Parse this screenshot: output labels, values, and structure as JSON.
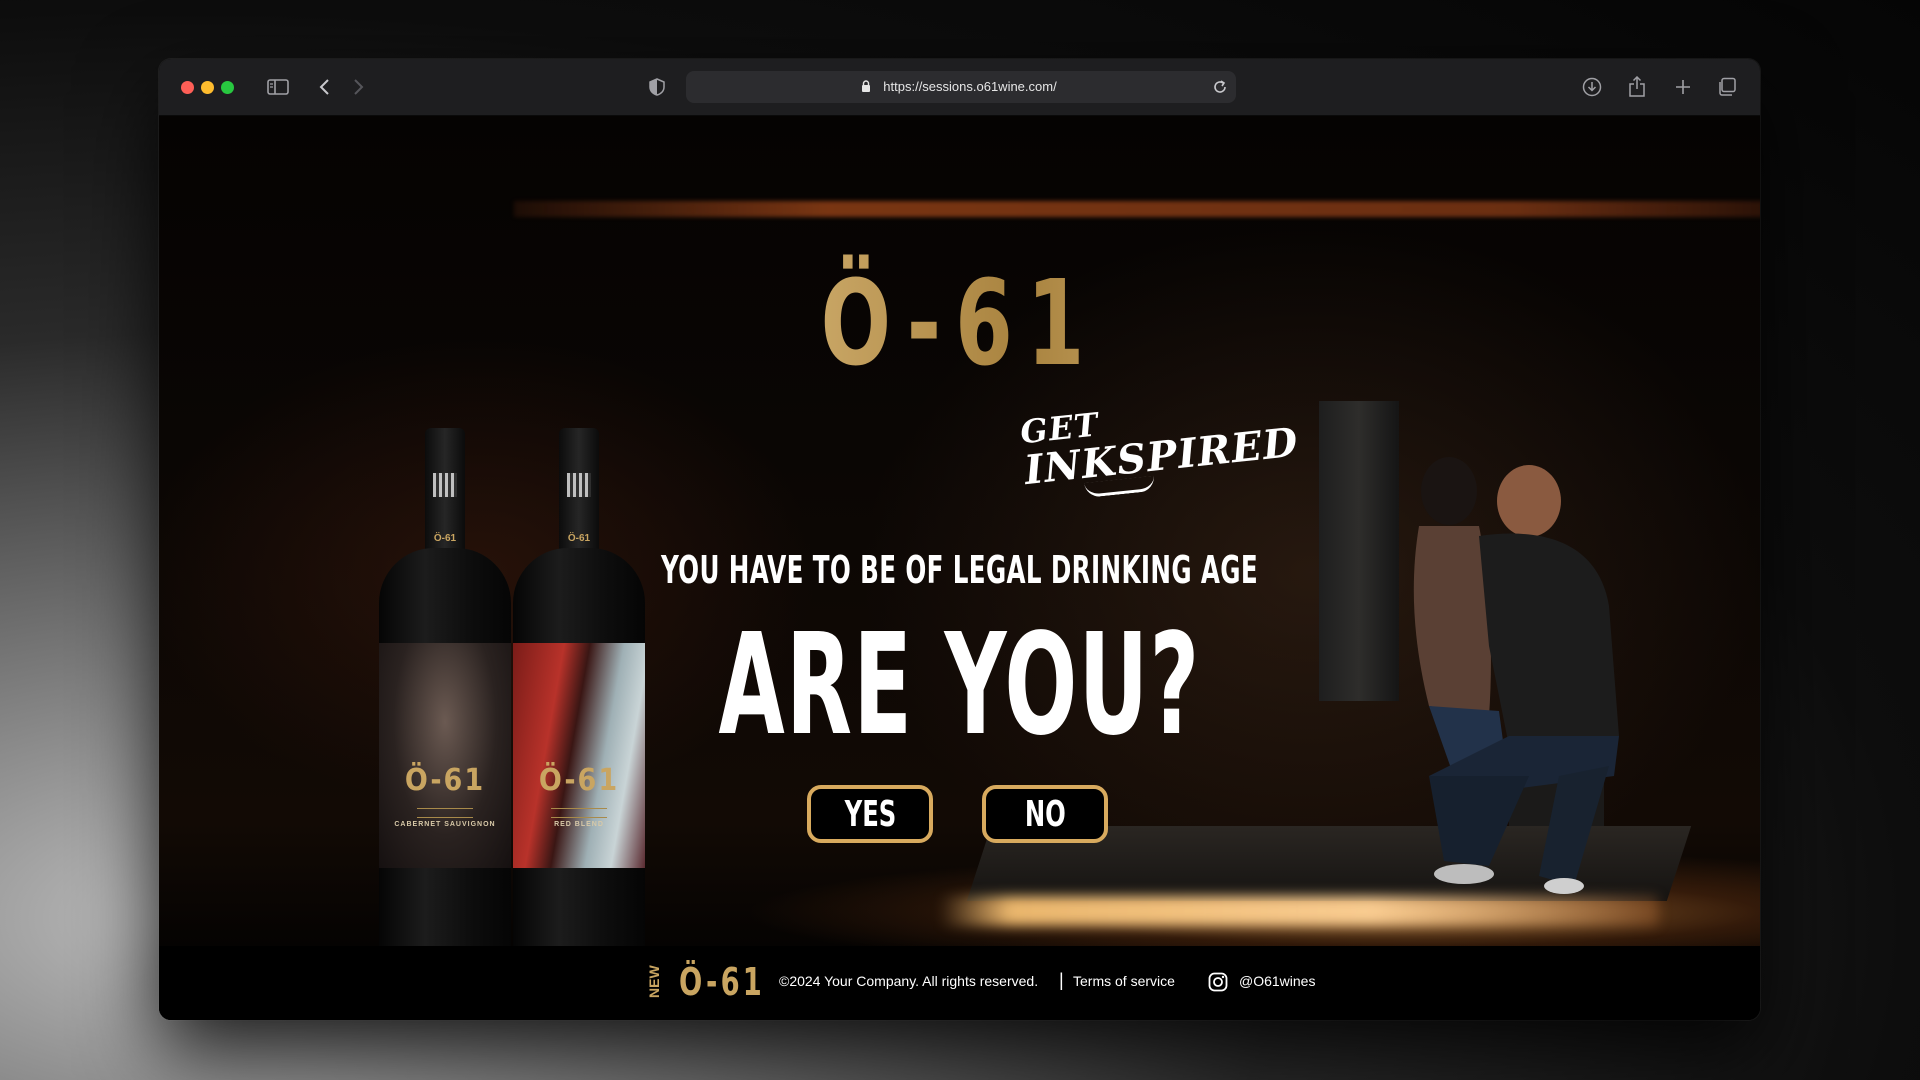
{
  "browser": {
    "url": "https://sessions.o61wine.com/",
    "traffic_lights": {
      "close": "#fe5f57",
      "minimize": "#febc2e",
      "zoom": "#28c840"
    },
    "toolbar_icons": [
      "sidebar-icon",
      "back-icon",
      "forward-icon",
      "shield-icon",
      "lock-icon",
      "reload-icon",
      "download-icon",
      "share-icon",
      "new-tab-icon",
      "tab-overview-icon"
    ]
  },
  "hero": {
    "brand": "Ö-61",
    "tagline_line1": "GET",
    "tagline_line2": "INKSPIRED",
    "age_notice": "YOU HAVE TO BE OF LEGAL DRINKING AGE",
    "question": "ARE YOU?",
    "yes_label": "YES",
    "no_label": "NO",
    "accent_color": "#d8aa5e"
  },
  "bottles": [
    {
      "brand": "Ö-61",
      "varietal": "CABERNET SAUVIGNON",
      "label_colors": [
        "#6b5a52",
        "#2a2220",
        "#8a7566"
      ]
    },
    {
      "brand": "Ö-61",
      "varietal": "RED BLEND",
      "label_colors": [
        "#b8322a",
        "#7a1c18",
        "#c9d4d6"
      ]
    }
  ],
  "footer": {
    "new_badge": "NEW",
    "brand": "Ö-61",
    "copyright": "©2024 Your Company. All rights reserved.",
    "separator": "|",
    "terms": "Terms of service",
    "instagram_handle": "@O61wines"
  }
}
